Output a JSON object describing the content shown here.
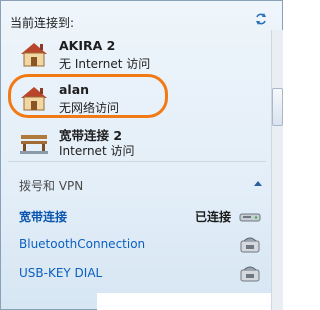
{
  "header": {
    "title": "当前连接到:"
  },
  "networks": [
    {
      "name": "AKIRA  2",
      "status": "无 Internet 访问",
      "icon": "house-network-icon"
    },
    {
      "name": "alan",
      "status": "无网络访问",
      "icon": "house-network-icon",
      "highlighted": true
    },
    {
      "name": "宽带连接  2",
      "status": "Internet 访问",
      "icon": "bench-network-icon"
    }
  ],
  "dialup": {
    "section_title": "拨号和 VPN",
    "items": [
      {
        "label": "宽带连接",
        "status": "已连接",
        "icon": "modem-icon"
      },
      {
        "label": "BluetoothConnection",
        "status": "",
        "icon": "phone-modem-icon"
      },
      {
        "label": "USB-KEY DIAL",
        "status": "",
        "icon": "phone-modem-icon"
      }
    ]
  },
  "colors": {
    "highlight": "#f27a14",
    "link": "#0b5fbf",
    "panel": "#e3eef8"
  }
}
